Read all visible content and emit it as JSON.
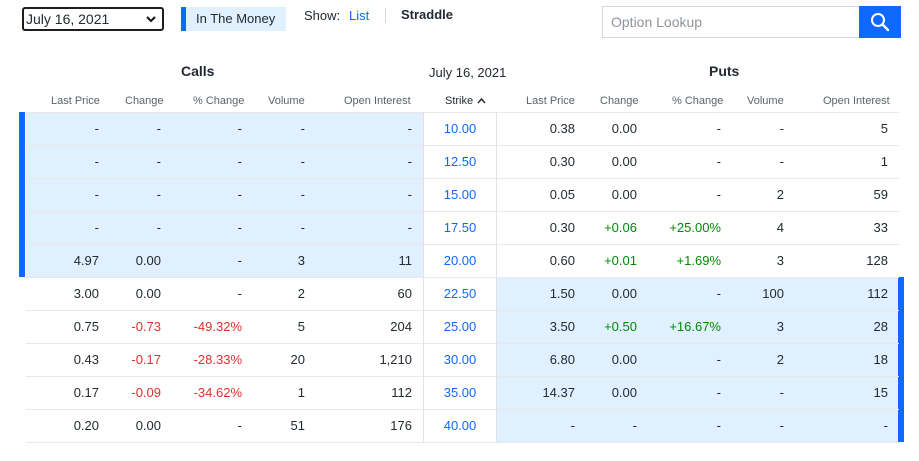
{
  "controls": {
    "expiration_select": "July 16, 2021",
    "in_the_money": "In The Money",
    "show_label": "Show:",
    "list_link": "List",
    "straddle_label": "Straddle",
    "search_placeholder": "Option Lookup"
  },
  "titles": {
    "calls": "Calls",
    "puts": "Puts",
    "expiration_date": "July 16, 2021"
  },
  "headers": {
    "calls": [
      "Last Price",
      "Change",
      "% Change",
      "Volume",
      "Open Interest"
    ],
    "strike": "Strike",
    "puts": [
      "Last Price",
      "Change",
      "% Change",
      "Volume",
      "Open Interest"
    ]
  },
  "colors": {
    "accent": "#0f69ff",
    "itm_background": "#e0f0ff",
    "positive": "#008a00",
    "negative": "#e0302d"
  },
  "rows": [
    {
      "calls": [
        "-",
        "-",
        "-",
        "-",
        "-"
      ],
      "strike": "10.00",
      "puts": [
        "0.38",
        "0.00",
        "-",
        "-",
        "5"
      ],
      "calls_itm": true,
      "puts_itm": false
    },
    {
      "calls": [
        "-",
        "-",
        "-",
        "-",
        "-"
      ],
      "strike": "12.50",
      "puts": [
        "0.30",
        "0.00",
        "-",
        "-",
        "1"
      ],
      "calls_itm": true,
      "puts_itm": false
    },
    {
      "calls": [
        "-",
        "-",
        "-",
        "-",
        "-"
      ],
      "strike": "15.00",
      "puts": [
        "0.05",
        "0.00",
        "-",
        "2",
        "59"
      ],
      "calls_itm": true,
      "puts_itm": false
    },
    {
      "calls": [
        "-",
        "-",
        "-",
        "-",
        "-"
      ],
      "strike": "17.50",
      "puts": [
        "0.30",
        "+0.06",
        "+25.00%",
        "4",
        "33"
      ],
      "calls_itm": true,
      "puts_itm": false
    },
    {
      "calls": [
        "4.97",
        "0.00",
        "-",
        "3",
        "11"
      ],
      "strike": "20.00",
      "puts": [
        "0.60",
        "+0.01",
        "+1.69%",
        "3",
        "128"
      ],
      "calls_itm": true,
      "puts_itm": false
    },
    {
      "calls": [
        "3.00",
        "0.00",
        "-",
        "2",
        "60"
      ],
      "strike": "22.50",
      "puts": [
        "1.50",
        "0.00",
        "-",
        "100",
        "112"
      ],
      "calls_itm": false,
      "puts_itm": true
    },
    {
      "calls": [
        "0.75",
        "-0.73",
        "-49.32%",
        "5",
        "204"
      ],
      "strike": "25.00",
      "puts": [
        "3.50",
        "+0.50",
        "+16.67%",
        "3",
        "28"
      ],
      "calls_itm": false,
      "puts_itm": true
    },
    {
      "calls": [
        "0.43",
        "-0.17",
        "-28.33%",
        "20",
        "1,210"
      ],
      "strike": "30.00",
      "puts": [
        "6.80",
        "0.00",
        "-",
        "2",
        "18"
      ],
      "calls_itm": false,
      "puts_itm": true
    },
    {
      "calls": [
        "0.17",
        "-0.09",
        "-34.62%",
        "1",
        "112"
      ],
      "strike": "35.00",
      "puts": [
        "14.37",
        "0.00",
        "-",
        "-",
        "15"
      ],
      "calls_itm": false,
      "puts_itm": true
    },
    {
      "calls": [
        "0.20",
        "0.00",
        "-",
        "51",
        "176"
      ],
      "strike": "40.00",
      "puts": [
        "-",
        "-",
        "-",
        "-",
        "-"
      ],
      "calls_itm": false,
      "puts_itm": true
    }
  ]
}
